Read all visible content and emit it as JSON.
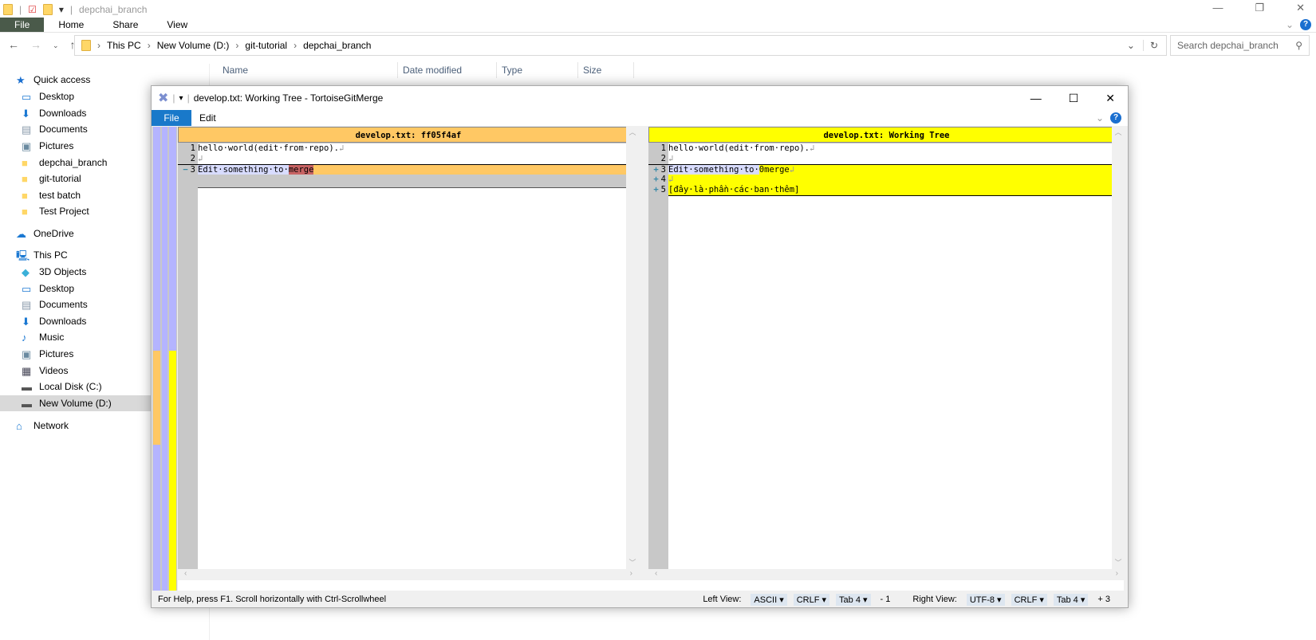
{
  "explorer": {
    "title": "depchai_branch",
    "ribbon_tabs": [
      "File",
      "Home",
      "Share",
      "View"
    ],
    "breadcrumb": [
      "This PC",
      "New Volume (D:)",
      "git-tutorial",
      "depchai_branch"
    ],
    "search_placeholder": "Search depchai_branch",
    "columns": [
      "Name",
      "Date modified",
      "Type",
      "Size"
    ],
    "nav": [
      {
        "label": "Quick access",
        "icon": "star-icon",
        "level": 0
      },
      {
        "label": "Desktop",
        "icon": "desktop-icon",
        "level": 1
      },
      {
        "label": "Downloads",
        "icon": "download-icon",
        "level": 1
      },
      {
        "label": "Documents",
        "icon": "documents-icon",
        "level": 1
      },
      {
        "label": "Pictures",
        "icon": "pictures-icon",
        "level": 1
      },
      {
        "label": "depchai_branch",
        "icon": "folder-conflict-icon",
        "level": 1
      },
      {
        "label": "git-tutorial",
        "icon": "folder-icon",
        "level": 1
      },
      {
        "label": "test batch",
        "icon": "folder-icon",
        "level": 1
      },
      {
        "label": "Test Project",
        "icon": "folder-ok-icon",
        "level": 1
      },
      {
        "label": "OneDrive",
        "icon": "cloud-icon",
        "level": 0
      },
      {
        "label": "This PC",
        "icon": "computer-icon",
        "level": 0
      },
      {
        "label": "3D Objects",
        "icon": "cube-icon",
        "level": 1
      },
      {
        "label": "Desktop",
        "icon": "desktop-icon",
        "level": 1
      },
      {
        "label": "Documents",
        "icon": "documents-icon",
        "level": 1
      },
      {
        "label": "Downloads",
        "icon": "download-icon",
        "level": 1
      },
      {
        "label": "Music",
        "icon": "music-icon",
        "level": 1
      },
      {
        "label": "Pictures",
        "icon": "pictures-icon",
        "level": 1
      },
      {
        "label": "Videos",
        "icon": "videos-icon",
        "level": 1
      },
      {
        "label": "Local Disk (C:)",
        "icon": "drive-icon",
        "level": 1
      },
      {
        "label": "New Volume (D:)",
        "icon": "drive-icon",
        "level": 1,
        "selected": true
      },
      {
        "label": "Network",
        "icon": "network-icon",
        "level": 0
      }
    ]
  },
  "merge": {
    "title": "develop.txt: Working Tree - TortoiseGitMerge",
    "menu": [
      "File",
      "Edit"
    ],
    "left": {
      "header": "develop.txt: ff05f4af",
      "lines": [
        {
          "n": "1",
          "mark": "",
          "text": "hello·world(edit·from·repo).",
          "eol": "↲",
          "state": "normal"
        },
        {
          "n": "2",
          "mark": "",
          "text": "",
          "eol": "↲",
          "state": "normal"
        },
        {
          "n": "3",
          "mark": "−",
          "text": "Edit·something·to·",
          "hl": "merge",
          "eol": "",
          "state": "removed"
        }
      ]
    },
    "right": {
      "header": "develop.txt: Working Tree",
      "lines": [
        {
          "n": "1",
          "mark": "",
          "text": "hello·world(edit·from·repo).",
          "eol": "↲",
          "state": "normal"
        },
        {
          "n": "2",
          "mark": "",
          "text": "",
          "eol": "↲",
          "state": "normal"
        },
        {
          "n": "3",
          "mark": "+",
          "text": "Edit·something·to·",
          "hl": "0merge",
          "eol": "↲",
          "state": "added"
        },
        {
          "n": "4",
          "mark": "+",
          "text": "",
          "eol": "↲",
          "state": "added"
        },
        {
          "n": "5",
          "mark": "+",
          "text": "[đây·là·phần·các·ban·thêm]",
          "eol": "",
          "state": "added"
        }
      ]
    },
    "status": {
      "help": "For Help, press F1. Scroll horizontally with Ctrl-Scrollwheel",
      "left_label": "Left View:",
      "left_enc": "ASCII",
      "left_eol": "CRLF",
      "left_tab": "Tab 4",
      "left_count": "- 1",
      "right_label": "Right View:",
      "right_enc": "UTF-8",
      "right_eol": "CRLF",
      "right_tab": "Tab 4",
      "right_count": "+ 3"
    },
    "colors": {
      "removed": "#ffc864",
      "added": "#ffff00",
      "locator": "#b4b4ff",
      "changed_word": "#c86464"
    }
  }
}
